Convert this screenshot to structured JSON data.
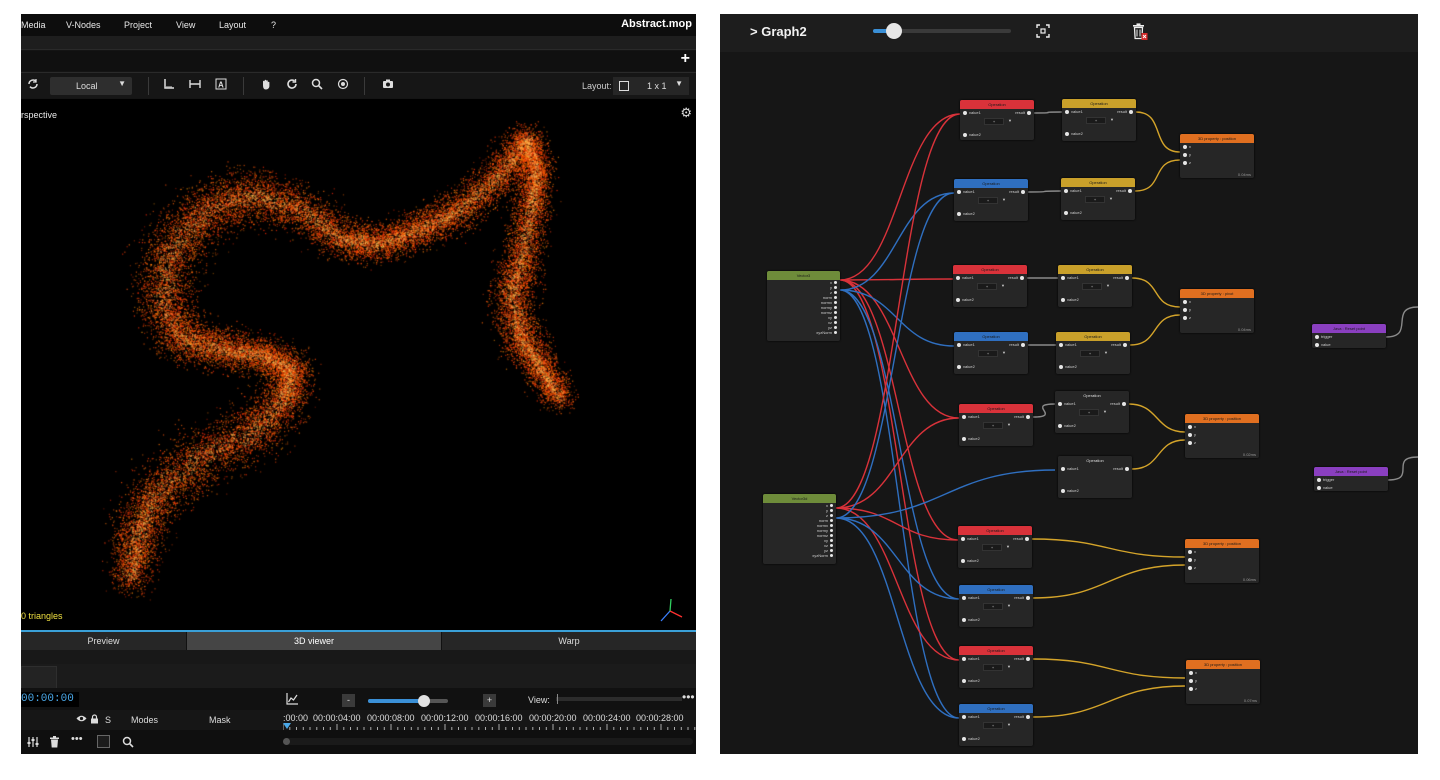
{
  "left_app": {
    "menu": [
      "Media",
      "V-Nodes",
      "Project",
      "View",
      "Layout",
      "?"
    ],
    "file_title": "Abstract.mop",
    "toolbar": {
      "coordinate_mode": "Local",
      "layout_label": "Layout:",
      "layout_value": "1 x 1"
    },
    "viewport": {
      "camera_label": "rspective",
      "status": "0 triangles"
    },
    "tabs": [
      {
        "label": "Preview",
        "active": false
      },
      {
        "label": "3D viewer",
        "active": true
      },
      {
        "label": "Warp",
        "active": false
      }
    ],
    "timeline": {
      "timecode": "00:00:00",
      "view_label": "View:",
      "zoom_minus": "-",
      "zoom_plus": "+",
      "zoom_level": 0.7,
      "col_s": "S",
      "col_modes": "Modes",
      "col_mask": "Mask",
      "ticks": [
        ":00:00",
        "00:00:04:00",
        "00:00:08:00",
        "00:00:12:00",
        "00:00:16:00",
        "00:00:20:00",
        "00:00:24:00",
        "00:00:28:00"
      ]
    }
  },
  "graph_editor": {
    "title": "> Graph2",
    "zoom_level": 0.15,
    "nodes": [
      {
        "id": "n1",
        "title": "Operation",
        "color": "#d9323a",
        "rows": [
          "value1",
          "value2"
        ],
        "output": "result",
        "select": "+"
      },
      {
        "id": "n2",
        "title": "Operation",
        "color": "#c9a02a",
        "rows": [
          "value1",
          "value2"
        ],
        "output": "result",
        "select": "+"
      },
      {
        "id": "n3",
        "title": "3D property : position",
        "color": "#e06f20",
        "rows": [
          "x",
          "y",
          "z"
        ],
        "output": "",
        "footer": "0.04ms"
      },
      {
        "id": "n4",
        "title": "Operation",
        "color": "#2f6fc0",
        "rows": [
          "value1",
          "value2"
        ],
        "output": "result",
        "select": "+"
      },
      {
        "id": "n5",
        "title": "Operation",
        "color": "#c9a02a",
        "rows": [
          "value1",
          "value2"
        ],
        "output": "result",
        "select": "+"
      },
      {
        "id": "n6",
        "title": "Vector3",
        "color": "#6e8c3a",
        "rows": [
          "x",
          "y",
          "z",
          "norm",
          "normx",
          "normy",
          "normz",
          "xy",
          "xz",
          "yz",
          "xyzNorm"
        ],
        "output": ""
      },
      {
        "id": "n7",
        "title": "Operation",
        "color": "#d9323a",
        "rows": [
          "value1",
          "value2"
        ],
        "output": "result",
        "select": "+"
      },
      {
        "id": "n8",
        "title": "Operation",
        "color": "#c9a02a",
        "rows": [
          "value1",
          "value2"
        ],
        "output": "result",
        "select": "+"
      },
      {
        "id": "n9",
        "title": "3D property : pivot",
        "color": "#e06f20",
        "rows": [
          "x",
          "y",
          "z"
        ],
        "output": "",
        "footer": "0.04ms"
      },
      {
        "id": "n10",
        "title": "Operation",
        "color": "#2f6fc0",
        "rows": [
          "value1",
          "value2"
        ],
        "output": "result",
        "select": "+"
      },
      {
        "id": "n11",
        "title": "Operation",
        "color": "#c9a02a",
        "rows": [
          "value1",
          "value2"
        ],
        "output": "result",
        "select": "+"
      },
      {
        "id": "n12",
        "title": "Operation",
        "color": "#d9323a",
        "rows": [
          "value1",
          "value2"
        ],
        "output": "result",
        "select": "+"
      },
      {
        "id": "n13",
        "title": "Operation",
        "color": "#262626",
        "rows": [
          "value1",
          "value2"
        ],
        "output": "result",
        "select": "+"
      },
      {
        "id": "n14",
        "title": "3D property : position",
        "color": "#e06f20",
        "rows": [
          "x",
          "y",
          "z"
        ],
        "output": "",
        "footer": "0.02ms"
      },
      {
        "id": "n15",
        "title": "Operation",
        "color": "#262626",
        "rows": [
          "value1",
          "value2"
        ],
        "output": "result",
        "select": ""
      },
      {
        "id": "n16",
        "title": "Vector3d",
        "color": "#6e8c3a",
        "rows": [
          "x",
          "y",
          "z",
          "norm",
          "normx",
          "normy",
          "normz",
          "xy",
          "xz",
          "yz",
          "xyzNorm"
        ],
        "output": ""
      },
      {
        "id": "n17",
        "title": "Operation",
        "color": "#d9323a",
        "rows": [
          "value1",
          "value2"
        ],
        "output": "result",
        "select": "+"
      },
      {
        "id": "n18",
        "title": "3D property : position",
        "color": "#e06f20",
        "rows": [
          "x",
          "y",
          "z"
        ],
        "output": "",
        "footer": "0.06ms"
      },
      {
        "id": "n19",
        "title": "Operation",
        "color": "#2f6fc0",
        "rows": [
          "value1",
          "value2"
        ],
        "output": "result",
        "select": "+"
      },
      {
        "id": "n20",
        "title": "Operation",
        "color": "#d9323a",
        "rows": [
          "value1",
          "value2"
        ],
        "output": "result",
        "select": "+"
      },
      {
        "id": "n21",
        "title": "3D property : position",
        "color": "#e06f20",
        "rows": [
          "x",
          "y",
          "z"
        ],
        "output": "",
        "footer": "0.07ms"
      },
      {
        "id": "n22",
        "title": "Operation",
        "color": "#2f6fc0",
        "rows": [
          "value1",
          "value2"
        ],
        "output": "result",
        "select": "+"
      },
      {
        "id": "n23",
        "title": "Java : Reset point",
        "color": "#8a3fc0",
        "rows": [
          "trigger",
          "value"
        ],
        "output": ""
      },
      {
        "id": "n24",
        "title": "Java : Reset point",
        "color": "#8a3fc0",
        "rows": [
          "trigger",
          "value"
        ],
        "output": ""
      }
    ]
  }
}
